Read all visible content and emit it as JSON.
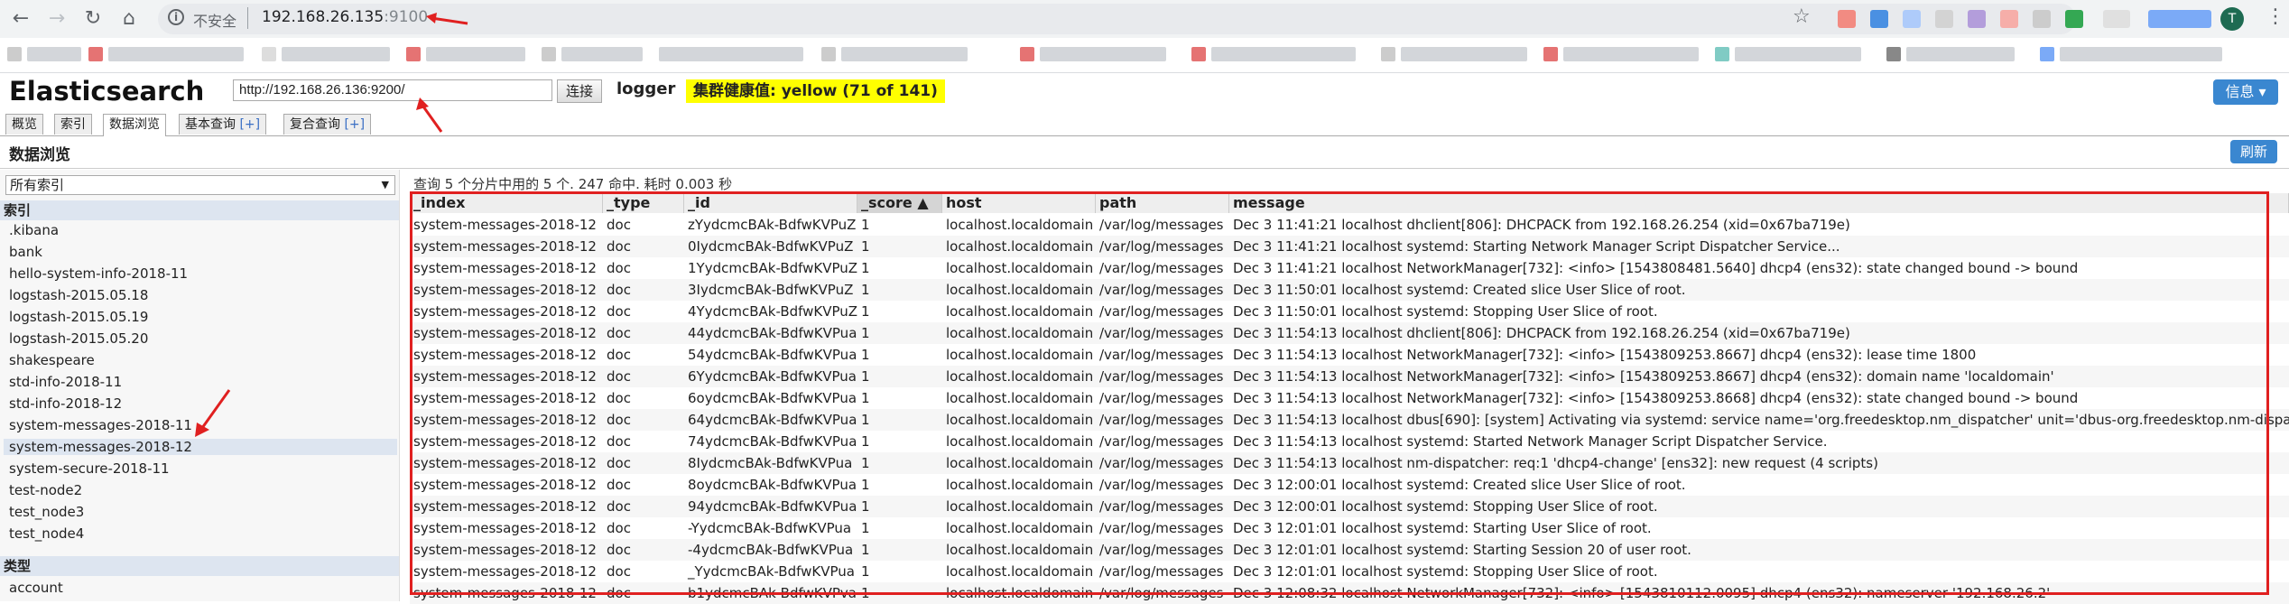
{
  "browser": {
    "insecure_label": "不安全",
    "url_host": "192.168.26.135",
    "url_port": ":9100",
    "avatar_letter": "T"
  },
  "app": {
    "title": "Elasticsearch",
    "es_url": "http://192.168.26.136:9200/",
    "connect_label": "连接",
    "cluster_name": "logger",
    "health": "集群健康值: yellow (71 of 141)",
    "info_label": "信息 ▾"
  },
  "tabs": [
    {
      "label": "概览"
    },
    {
      "label": "索引"
    },
    {
      "label": "数据浏览"
    },
    {
      "label": "基本查询",
      "plus": "[+]"
    },
    {
      "label": "复合查询",
      "plus": "[+]"
    }
  ],
  "section": {
    "title": "数据浏览",
    "refresh_label": "刷新"
  },
  "sidebar": {
    "select_value": "所有索引",
    "indices_heading": "索引",
    "indices": [
      ".kibana",
      "bank",
      "hello-system-info-2018-11",
      "logstash-2015.05.18",
      "logstash-2015.05.19",
      "logstash-2015.05.20",
      "shakespeare",
      "std-info-2018-11",
      "std-info-2018-12",
      "system-messages-2018-11",
      "system-messages-2018-12",
      "system-secure-2018-11",
      "test-node2",
      "test_node3",
      "test_node4"
    ],
    "selected_index": 10,
    "types_heading": "类型",
    "types": [
      "account"
    ]
  },
  "results": {
    "summary": "查询 5 个分片中用的 5 个. 247 命中. 耗时 0.003 秒",
    "columns": [
      "_index",
      "_type",
      "_id",
      "_score ▲",
      "host",
      "path",
      "message"
    ],
    "rows": [
      [
        "system-messages-2018-12",
        "doc",
        "zYydcmcBAk-BdfwKVPuZ",
        "1",
        "localhost.localdomain",
        "/var/log/messages",
        "Dec 3 11:41:21 localhost dhclient[806]: DHCPACK from 192.168.26.254 (xid=0x67ba719e)"
      ],
      [
        "system-messages-2018-12",
        "doc",
        "0IydcmcBAk-BdfwKVPuZ",
        "1",
        "localhost.localdomain",
        "/var/log/messages",
        "Dec 3 11:41:21 localhost systemd: Starting Network Manager Script Dispatcher Service..."
      ],
      [
        "system-messages-2018-12",
        "doc",
        "1YydcmcBAk-BdfwKVPuZ",
        "1",
        "localhost.localdomain",
        "/var/log/messages",
        "Dec 3 11:41:21 localhost NetworkManager[732]: <info> [1543808481.5640] dhcp4 (ens32): state changed bound -> bound"
      ],
      [
        "system-messages-2018-12",
        "doc",
        "3IydcmcBAk-BdfwKVPuZ",
        "1",
        "localhost.localdomain",
        "/var/log/messages",
        "Dec 3 11:50:01 localhost systemd: Created slice User Slice of root."
      ],
      [
        "system-messages-2018-12",
        "doc",
        "4YydcmcBAk-BdfwKVPuZ",
        "1",
        "localhost.localdomain",
        "/var/log/messages",
        "Dec 3 11:50:01 localhost systemd: Stopping User Slice of root."
      ],
      [
        "system-messages-2018-12",
        "doc",
        "44ydcmcBAk-BdfwKVPua",
        "1",
        "localhost.localdomain",
        "/var/log/messages",
        "Dec 3 11:54:13 localhost dhclient[806]: DHCPACK from 192.168.26.254 (xid=0x67ba719e)"
      ],
      [
        "system-messages-2018-12",
        "doc",
        "54ydcmcBAk-BdfwKVPua",
        "1",
        "localhost.localdomain",
        "/var/log/messages",
        "Dec 3 11:54:13 localhost NetworkManager[732]: <info> [1543809253.8667] dhcp4 (ens32): lease time 1800"
      ],
      [
        "system-messages-2018-12",
        "doc",
        "6YydcmcBAk-BdfwKVPua",
        "1",
        "localhost.localdomain",
        "/var/log/messages",
        "Dec 3 11:54:13 localhost NetworkManager[732]: <info> [1543809253.8667] dhcp4 (ens32): domain name 'localdomain'"
      ],
      [
        "system-messages-2018-12",
        "doc",
        "6oydcmcBAk-BdfwKVPua",
        "1",
        "localhost.localdomain",
        "/var/log/messages",
        "Dec 3 11:54:13 localhost NetworkManager[732]: <info> [1543809253.8668] dhcp4 (ens32): state changed bound -> bound"
      ],
      [
        "system-messages-2018-12",
        "doc",
        "64ydcmcBAk-BdfwKVPua",
        "1",
        "localhost.localdomain",
        "/var/log/messages",
        "Dec 3 11:54:13 localhost dbus[690]: [system] Activating via systemd: service name='org.freedesktop.nm_dispatcher' unit='dbus-org.freedesktop.nm-dispa"
      ],
      [
        "system-messages-2018-12",
        "doc",
        "74ydcmcBAk-BdfwKVPua",
        "1",
        "localhost.localdomain",
        "/var/log/messages",
        "Dec 3 11:54:13 localhost systemd: Started Network Manager Script Dispatcher Service."
      ],
      [
        "system-messages-2018-12",
        "doc",
        "8IydcmcBAk-BdfwKVPua",
        "1",
        "localhost.localdomain",
        "/var/log/messages",
        "Dec 3 11:54:13 localhost nm-dispatcher: req:1 'dhcp4-change' [ens32]: new request (4 scripts)"
      ],
      [
        "system-messages-2018-12",
        "doc",
        "8oydcmcBAk-BdfwKVPua",
        "1",
        "localhost.localdomain",
        "/var/log/messages",
        "Dec 3 12:00:01 localhost systemd: Created slice User Slice of root."
      ],
      [
        "system-messages-2018-12",
        "doc",
        "94ydcmcBAk-BdfwKVPua",
        "1",
        "localhost.localdomain",
        "/var/log/messages",
        "Dec 3 12:00:01 localhost systemd: Stopping User Slice of root."
      ],
      [
        "system-messages-2018-12",
        "doc",
        "-YydcmcBAk-BdfwKVPua",
        "1",
        "localhost.localdomain",
        "/var/log/messages",
        "Dec 3 12:01:01 localhost systemd: Starting User Slice of root."
      ],
      [
        "system-messages-2018-12",
        "doc",
        "-4ydcmcBAk-BdfwKVPua",
        "1",
        "localhost.localdomain",
        "/var/log/messages",
        "Dec 3 12:01:01 localhost systemd: Starting Session 20 of user root."
      ],
      [
        "system-messages-2018-12",
        "doc",
        "_YydcmcBAk-BdfwKVPua",
        "1",
        "localhost.localdomain",
        "/var/log/messages",
        "Dec 3 12:01:01 localhost systemd: Stopping User Slice of root."
      ],
      [
        "system-messages-2018-12",
        "doc",
        "b1ydcmcBAk-BdfwKVPva",
        "1",
        "localhost.localdomain",
        "/var/log/messages",
        "Dec 3 12:08:32 localhost NetworkManager[732]: <info> [1543810112.0095] dhcp4 (ens32): nameserver '192.168.26.2'"
      ]
    ]
  }
}
